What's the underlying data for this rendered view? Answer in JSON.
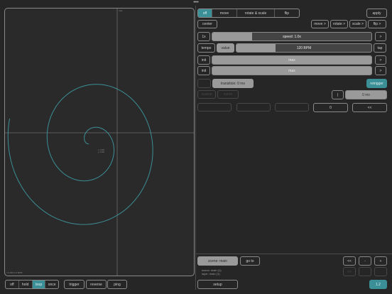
{
  "window": {
    "dots": "•••"
  },
  "canvas": {
    "top_label": "max",
    "center_label": "x: 0.00\ny: 0.00",
    "bottom_label": "t: 0.000  1.0 BPM",
    "curve_color": "#3b8f96"
  },
  "mode_segments": {
    "items": [
      {
        "label": "off",
        "active": true
      },
      {
        "label": "move",
        "active": false
      },
      {
        "label": "rotate & scale",
        "active": false
      },
      {
        "label": "flip",
        "active": false
      }
    ]
  },
  "apply_label": "apply",
  "center_label": "center",
  "toolbar_right": [
    "move >",
    "rotate >",
    "scale >",
    "flip >"
  ],
  "speed": {
    "multiplier": "1x",
    "label": "speed: 1.0x",
    "arrow": ">"
  },
  "tempo": {
    "tempo_label": "tempo",
    "value_label": "value",
    "bpm_label": "120 BPM",
    "tap_label": "tap"
  },
  "row_x": {
    "mode": "init",
    "label": "max",
    "arrow": ">"
  },
  "row_y": {
    "mode": "init",
    "label": "max",
    "arrow": ">"
  },
  "transition": {
    "label": "transition: 0 ms",
    "retrigger_label": "retrigger"
  },
  "dim_labels": {
    "left": "source",
    "right": "curve"
  },
  "duration": {
    "arrow": "|",
    "label": "0 ms"
  },
  "row_buttons": {
    "zero": "0",
    "double_arrow": "<<"
  },
  "scene": {
    "name": "scene: main",
    "goto_label": "go to",
    "info_line1": "scene: main (1)",
    "info_line2": "layer: main (1)",
    "nav": [
      "<<",
      "-",
      "+"
    ]
  },
  "setup_label": "setup",
  "version_label": "1.2",
  "playback": {
    "loop_modes": [
      {
        "label": "off",
        "active": false
      },
      {
        "label": "hold",
        "active": false
      },
      {
        "label": "loop",
        "active": true
      },
      {
        "label": "once",
        "active": false
      }
    ],
    "trigger_label": "trigger",
    "reverse_label": "reverse",
    "ping_label": "ping"
  },
  "colors": {
    "accent": "#3b8f96",
    "background": "#262626",
    "border": "#8a8a8a"
  }
}
